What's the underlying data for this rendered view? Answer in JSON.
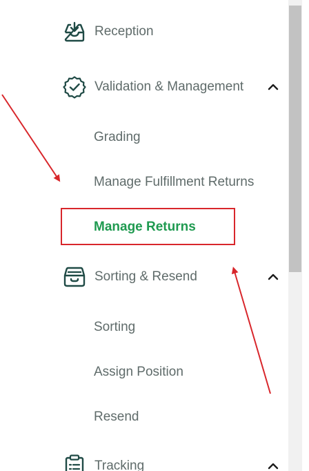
{
  "menu": {
    "reception": {
      "label": "Reception",
      "icon": "inbox-download-icon"
    },
    "validation": {
      "label": "Validation & Management",
      "icon": "badge-check-icon",
      "expanded": true,
      "items": [
        "Grading",
        "Manage Fulfillment Returns",
        "Manage Returns"
      ],
      "active": "Manage Returns"
    },
    "sorting": {
      "label": "Sorting & Resend",
      "icon": "tray-box-icon",
      "expanded": true,
      "items": [
        "Sorting",
        "Assign Position",
        "Resend"
      ]
    },
    "tracking": {
      "label": "Tracking",
      "icon": "clipboard-list-icon",
      "expanded": true
    }
  },
  "colors": {
    "text": "#5f6b6a",
    "active": "#1f9a50",
    "icon": "#1f4a45",
    "annotation": "#d8262b"
  }
}
